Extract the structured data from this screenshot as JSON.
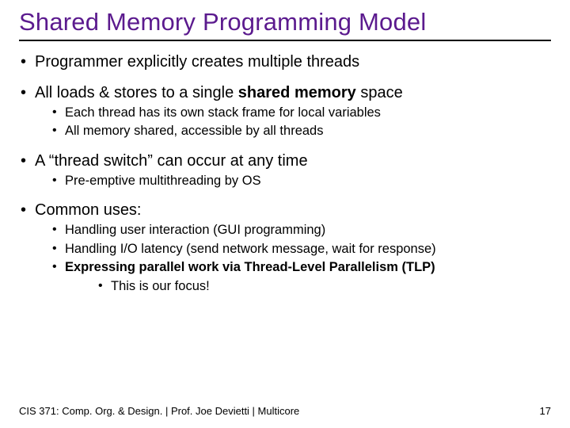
{
  "title": "Shared Memory Programming Model",
  "bullets": {
    "b1": "Programmer explicitly creates multiple threads",
    "b2_pre": "All loads & stores to a single ",
    "b2_bold": "shared memory",
    "b2_post": " space",
    "b2_sub1": "Each thread has its own stack frame for local variables",
    "b2_sub2": "All memory shared, accessible by all threads",
    "b3": "A “thread switch” can occur at any time",
    "b3_sub1": "Pre-emptive multithreading by OS",
    "b4": "Common uses:",
    "b4_sub1": "Handling user interaction (GUI programming)",
    "b4_sub2": "Handling I/O latency (send network message, wait for response)",
    "b4_sub3": "Expressing parallel work via Thread-Level Parallelism (TLP)",
    "b4_sub3_sub1": "This is our focus!"
  },
  "footer": {
    "left": "CIS 371: Comp. Org. & Design. |  Prof. Joe Devietti  |  Multicore",
    "page": "17"
  }
}
